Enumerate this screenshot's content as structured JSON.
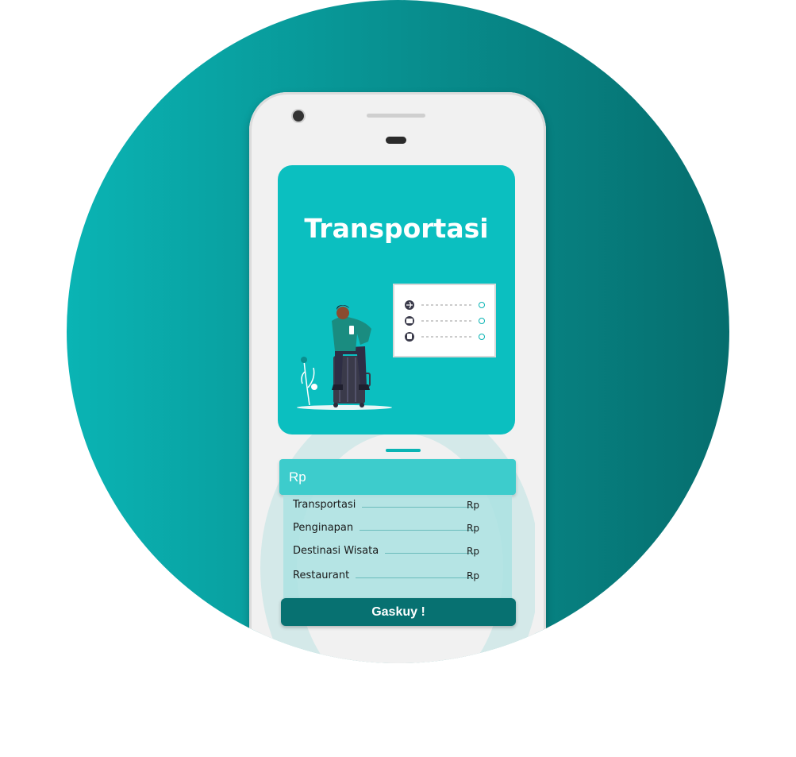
{
  "hero": {
    "title": "Transportasi"
  },
  "itinerary_icons": [
    "plane-icon",
    "bus-icon",
    "train-icon"
  ],
  "budget_input": {
    "placeholder": "Rp"
  },
  "breakdown": [
    {
      "label": "Transportasi",
      "value": "Rp"
    },
    {
      "label": "Penginapan",
      "value": "Rp"
    },
    {
      "label": "Destinasi Wisata",
      "value": "Rp"
    },
    {
      "label": "Restaurant",
      "value": "Rp"
    }
  ],
  "cta": {
    "label": "Gaskuy !"
  },
  "colors": {
    "brand": "#0bbfc0",
    "dark": "#077171",
    "accent_light": "#3dcccc"
  }
}
